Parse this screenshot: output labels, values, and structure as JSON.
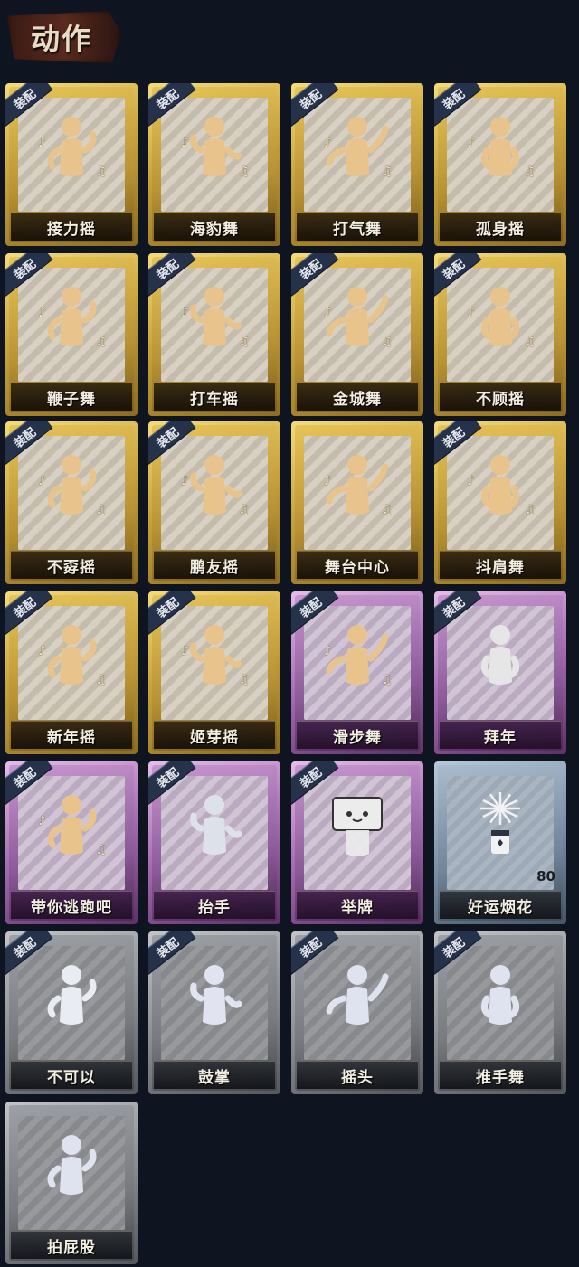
{
  "header": {
    "title": "动作"
  },
  "equip_label": "装配",
  "cards": [
    {
      "label": "接力摇",
      "rarity": "gold",
      "equipped": true,
      "icon": "figure-dance-icon",
      "tint": "#e8c48c"
    },
    {
      "label": "海豹舞",
      "rarity": "gold",
      "equipped": true,
      "icon": "figure-clap-icon",
      "tint": "#e8c48c"
    },
    {
      "label": "打气舞",
      "rarity": "gold",
      "equipped": true,
      "icon": "figure-cheer-icon",
      "tint": "#e8c48c"
    },
    {
      "label": "孤身摇",
      "rarity": "gold",
      "equipped": true,
      "icon": "figure-sway-icon",
      "tint": "#e8c48c"
    },
    {
      "label": "鞭子舞",
      "rarity": "gold",
      "equipped": true,
      "icon": "figure-whip-icon",
      "tint": "#e8c48c"
    },
    {
      "label": "打车摇",
      "rarity": "gold",
      "equipped": true,
      "icon": "figure-taxi-icon",
      "tint": "#e8c48c"
    },
    {
      "label": "金城舞",
      "rarity": "gold",
      "equipped": true,
      "icon": "figure-wave-icon",
      "tint": "#e8c48c"
    },
    {
      "label": "不顾摇",
      "rarity": "gold",
      "equipped": true,
      "icon": "figure-point-icon",
      "tint": "#e8c48c"
    },
    {
      "label": "不孬摇",
      "rarity": "gold",
      "equipped": true,
      "icon": "figure-raise-icon",
      "tint": "#e8c48c"
    },
    {
      "label": "鹏友摇",
      "rarity": "gold",
      "equipped": true,
      "icon": "figure-cross-icon",
      "tint": "#e8c48c"
    },
    {
      "label": "舞台中心",
      "rarity": "gold",
      "equipped": false,
      "icon": "figure-center-icon",
      "tint": "#e8c48c"
    },
    {
      "label": "抖肩舞",
      "rarity": "gold",
      "equipped": true,
      "icon": "figure-shrug-icon",
      "tint": "#e8c48c"
    },
    {
      "label": "新年摇",
      "rarity": "gold",
      "equipped": true,
      "icon": "figure-newyear-icon",
      "tint": "#e8c48c"
    },
    {
      "label": "姬芽摇",
      "rarity": "gold",
      "equipped": true,
      "icon": "figure-sprout-icon",
      "tint": "#e8c48c"
    },
    {
      "label": "滑步舞",
      "rarity": "purple",
      "equipped": true,
      "icon": "figure-slide-icon",
      "tint": "#e8c48c"
    },
    {
      "label": "拜年",
      "rarity": "purple",
      "equipped": true,
      "icon": "figure-greet-icon",
      "tint": "#e6e6e6"
    },
    {
      "label": "带你逃跑吧",
      "rarity": "purple",
      "equipped": true,
      "icon": "figure-run-icon",
      "tint": "#e8c48c"
    },
    {
      "label": "抬手",
      "rarity": "purple",
      "equipped": true,
      "icon": "hand-raise-icon",
      "tint": "#dde2ea"
    },
    {
      "label": "举牌",
      "rarity": "purple",
      "equipped": true,
      "icon": "sign-hold-icon",
      "tint": "#ececec"
    },
    {
      "label": "好运烟花",
      "rarity": "blue",
      "equipped": false,
      "icon": "firework-icon",
      "tint": "#f2f2f2",
      "count": "80"
    },
    {
      "label": "不可以",
      "rarity": "grey",
      "equipped": true,
      "icon": "finger-wag-icon",
      "tint": "#e9ecf2"
    },
    {
      "label": "鼓掌",
      "rarity": "grey",
      "equipped": true,
      "icon": "clap-hands-icon",
      "tint": "#e1e4f0"
    },
    {
      "label": "摇头",
      "rarity": "grey",
      "equipped": true,
      "icon": "head-shake-icon",
      "tint": "#dfe2ef"
    },
    {
      "label": "推手舞",
      "rarity": "grey",
      "equipped": true,
      "icon": "push-hands-icon",
      "tint": "#dfe2ef"
    },
    {
      "label": "拍屁股",
      "rarity": "grey",
      "equipped": false,
      "icon": "butt-pat-icon",
      "tint": "#dfe2ef"
    }
  ]
}
